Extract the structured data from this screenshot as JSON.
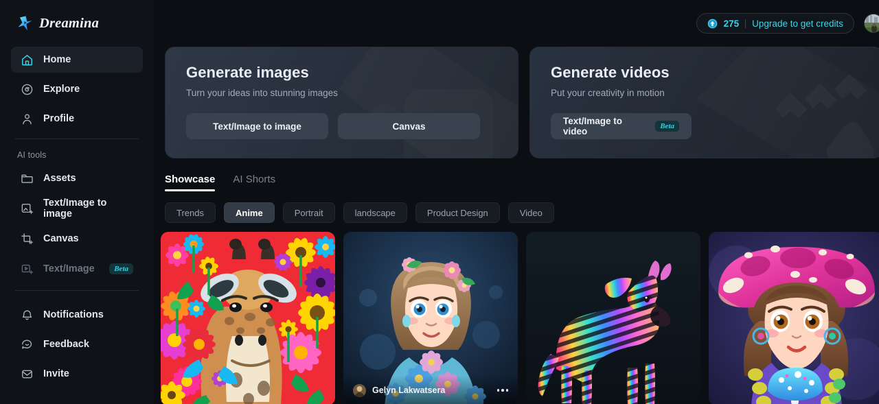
{
  "brand": {
    "name": "Dreamina",
    "logo_icon": "star-sparkle-icon"
  },
  "sidebar": {
    "primary": [
      {
        "label": "Home",
        "icon": "home-icon",
        "active": true
      },
      {
        "label": "Explore",
        "icon": "compass-icon",
        "active": false
      },
      {
        "label": "Profile",
        "icon": "user-icon",
        "active": false
      }
    ],
    "section_label": "AI tools",
    "tools": [
      {
        "label": "Assets",
        "icon": "folder-icon",
        "muted": false,
        "badge": ""
      },
      {
        "label": "Text/Image to image",
        "icon": "image-spark-icon",
        "muted": false,
        "badge": ""
      },
      {
        "label": "Canvas",
        "icon": "canvas-crop-icon",
        "muted": false,
        "badge": ""
      },
      {
        "label": "Text/Image t...",
        "icon": "video-spark-icon",
        "muted": true,
        "badge": "Beta"
      }
    ],
    "footer": [
      {
        "label": "Notifications",
        "icon": "bell-icon"
      },
      {
        "label": "Feedback",
        "icon": "chat-icon"
      },
      {
        "label": "Invite",
        "icon": "invite-box-icon"
      }
    ]
  },
  "topbar": {
    "credits": "275",
    "upgrade_label": "Upgrade to get credits",
    "credit_icon": "credit-coin-icon",
    "avatar_name": "user-avatar"
  },
  "banners": [
    {
      "title": "Generate images",
      "subtitle": "Turn your ideas into stunning images",
      "buttons": [
        {
          "label": "Text/Image to image",
          "badge": ""
        },
        {
          "label": "Canvas",
          "badge": ""
        }
      ]
    },
    {
      "title": "Generate videos",
      "subtitle": "Put your creativity in motion",
      "buttons": [
        {
          "label": "Text/Image to video",
          "badge": "Beta"
        }
      ]
    }
  ],
  "tabs": [
    {
      "label": "Showcase",
      "active": true
    },
    {
      "label": "AI Shorts",
      "active": false
    }
  ],
  "chips": [
    {
      "label": "Trends",
      "active": false
    },
    {
      "label": "Anime",
      "active": true
    },
    {
      "label": "Portrait",
      "active": false
    },
    {
      "label": "landscape",
      "active": false
    },
    {
      "label": "Product Design",
      "active": false
    },
    {
      "label": "Video",
      "active": false
    }
  ],
  "gallery": [
    {
      "art": "giraffe-flowers",
      "author": "",
      "show_overlay": false
    },
    {
      "art": "anime-girl-flowers",
      "author": "Gelyn Lakwatsera",
      "show_overlay": true
    },
    {
      "art": "rainbow-zebra",
      "author": "",
      "show_overlay": false
    },
    {
      "art": "mushroom-girl",
      "author": "",
      "show_overlay": false
    }
  ],
  "colors": {
    "accent_cyan": "#3fd3e6",
    "sidebar_bg": "#0f1318",
    "main_bg": "#0b0e13",
    "chip_active_bg": "#333b47"
  }
}
